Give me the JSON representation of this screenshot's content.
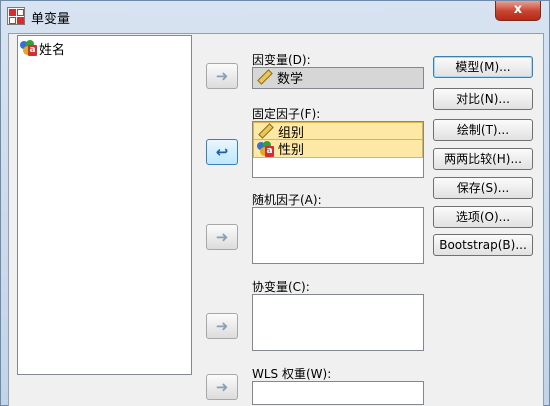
{
  "window": {
    "title": "单变量",
    "close_glyph": "x"
  },
  "source_list": {
    "items": [
      {
        "label": "姓名",
        "icon": "nominal-variable-icon"
      }
    ]
  },
  "dependent": {
    "label": "因变量(D):",
    "value": "数学",
    "icon": "scale-variable-icon"
  },
  "fixed_factors": {
    "label": "固定因子(F):",
    "items": [
      {
        "label": "组别",
        "icon": "scale-variable-icon"
      },
      {
        "label": "性别",
        "icon": "nominal-variable-icon"
      }
    ]
  },
  "random_factors": {
    "label": "随机因子(A):"
  },
  "covariates": {
    "label": "协变量(C):"
  },
  "wls_weight": {
    "label": "WLS 权重(W):"
  },
  "buttons": {
    "model": "模型(M)...",
    "contrast": "对比(N)...",
    "plots": "绘制(T)...",
    "post_hoc": "两两比较(H)...",
    "save": "保存(S)...",
    "options": "选项(O)...",
    "bootstrap": "Bootstrap(B)..."
  },
  "arrows": {
    "right": "➜",
    "left": "↩"
  },
  "colors": {
    "selection": "#fde8a6",
    "title_bar": "#d7e3f1",
    "close_button": "#c7432f"
  }
}
